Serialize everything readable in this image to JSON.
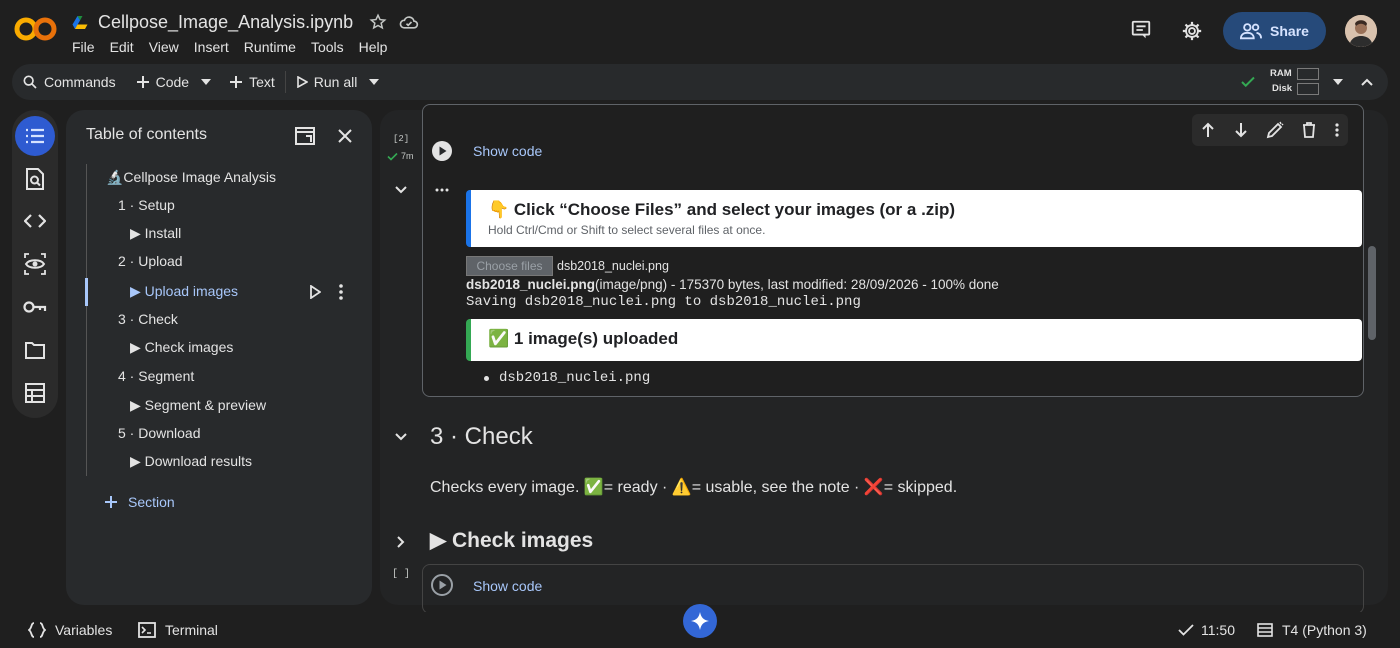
{
  "header": {
    "title": "Cellpose_Image_Analysis.ipynb",
    "menus": [
      "File",
      "Edit",
      "View",
      "Insert",
      "Runtime",
      "Tools",
      "Help"
    ],
    "share_label": "Share"
  },
  "toolbar": {
    "commands_label": "Commands",
    "code_label": "Code",
    "text_label": "Text",
    "run_all_label": "Run all",
    "ram_label": "RAM",
    "disk_label": "Disk"
  },
  "toc": {
    "title": "Table of contents",
    "items": [
      {
        "label": "🔬Cellpose Image Analysis",
        "level": 0
      },
      {
        "label": "1 · Setup",
        "level": 1
      },
      {
        "label": "▶ Install",
        "level": 2
      },
      {
        "label": "2 · Upload",
        "level": 1
      },
      {
        "label": "▶ Upload images",
        "level": 2,
        "selected": true
      },
      {
        "label": "3 · Check",
        "level": 1
      },
      {
        "label": "▶ Check images",
        "level": 2
      },
      {
        "label": "4 · Segment",
        "level": 1
      },
      {
        "label": "▶ Segment & preview",
        "level": 2
      },
      {
        "label": "5 · Download",
        "level": 1
      },
      {
        "label": "▶ Download results",
        "level": 2
      }
    ],
    "add_section_label": "Section"
  },
  "notebook": {
    "cell1": {
      "exec_count": "[2]",
      "exec_time": "7m",
      "show_code": "Show code",
      "banner_title": "👇 Click “Choose Files” and select your images (or a .zip)",
      "banner_sub": "Hold Ctrl/Cmd or Shift to select several files at once.",
      "choose_files": "Choose files",
      "chosen_file": "dsb2018_nuclei.png",
      "upload_name": "dsb2018_nuclei.png",
      "upload_detail": "(image/png) - 175370 bytes, last modified: 28/09/2026 - 100% done",
      "saving_line": "Saving dsb2018_nuclei.png to dsb2018_nuclei.png",
      "uploaded_banner": "✅ 1 image(s) uploaded",
      "bullet_file": "dsb2018_nuclei.png"
    },
    "section_heading": "3 · Check",
    "section_text": "Checks every image. ✅= ready · ⚠️= usable, see the note · ❌= skipped.",
    "collapsed_heading": "▶ Check images",
    "cell2": {
      "exec_count": "[ ]",
      "show_code": "Show code"
    }
  },
  "statusbar": {
    "variables": "Variables",
    "terminal": "Terminal",
    "time": "11:50",
    "runtime": "T4 (Python 3)"
  },
  "colors": {
    "accent_blue": "#a8c7fa",
    "share_bg": "#264a7a",
    "green_check": "#34a853",
    "logo_orange": "#f9ab00"
  }
}
